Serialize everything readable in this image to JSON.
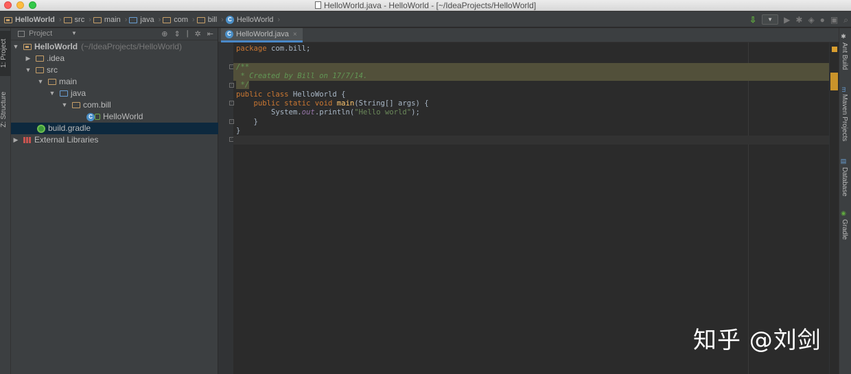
{
  "window": {
    "title": "HelloWorld.java - HelloWorld - [~/IdeaProjects/HelloWorld]"
  },
  "navbar": {
    "breadcrumbs": [
      {
        "label": "HelloWorld",
        "icon": "project-folder-icon"
      },
      {
        "label": "src",
        "icon": "folder-icon"
      },
      {
        "label": "main",
        "icon": "folder-icon"
      },
      {
        "label": "java",
        "icon": "folder-icon"
      },
      {
        "label": "com",
        "icon": "folder-icon"
      },
      {
        "label": "bill",
        "icon": "folder-icon"
      },
      {
        "label": "HelloWorld",
        "icon": "class-icon"
      }
    ]
  },
  "left_tool_windows": {
    "project": "1: Project",
    "structure": "Z: Structure"
  },
  "right_tool_windows": {
    "ant": "Ant Build",
    "maven": "Maven Projects",
    "database": "Database",
    "gradle": "Gradle"
  },
  "project_panel": {
    "view_selector": "Project",
    "tree": [
      {
        "label": "HelloWorld",
        "path_hint": "(~/IdeaProjects/HelloWorld)",
        "expanded": true,
        "depth": 0,
        "icon": "project-folder-icon",
        "bold": true
      },
      {
        "label": ".idea",
        "expanded": false,
        "depth": 1,
        "icon": "folder-icon"
      },
      {
        "label": "src",
        "expanded": true,
        "depth": 1,
        "icon": "folder-icon"
      },
      {
        "label": "main",
        "expanded": true,
        "depth": 2,
        "icon": "folder-icon"
      },
      {
        "label": "java",
        "expanded": true,
        "depth": 3,
        "icon": "source-folder-icon"
      },
      {
        "label": "com.bill",
        "expanded": true,
        "depth": 4,
        "icon": "package-icon"
      },
      {
        "label": "HelloWorld",
        "depth": 5,
        "icon": "class-icon"
      },
      {
        "label": "build.gradle",
        "depth": 1,
        "icon": "gradle-icon",
        "selected": true
      },
      {
        "label": "External Libraries",
        "expanded": false,
        "depth": 0,
        "icon": "libraries-icon"
      }
    ]
  },
  "editor": {
    "tab_label": "HelloWorld.java",
    "lines": [
      "package com.bill;",
      "",
      "/**",
      " * Created by Bill on 17/7/14.",
      " */",
      "public class HelloWorld {",
      "    public static void main(String[] args) {",
      "        System.out.println(\"Hello world\");",
      "    }",
      "}",
      ""
    ]
  },
  "watermark": "知乎 @刘剑"
}
